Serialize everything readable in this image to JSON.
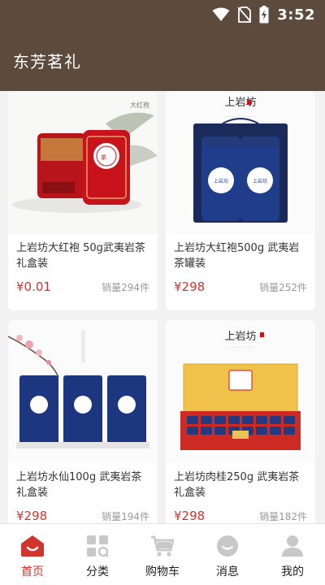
{
  "status_bar": {
    "time": "3:52"
  },
  "app_bar": {
    "title": "东芳茗礼"
  },
  "products": [
    {
      "title": "上岩坊大红袍 50g武夷岩茶礼盒装",
      "price": "¥0.01",
      "sales": "销量294件",
      "image": "red-tin-gift-box"
    },
    {
      "title": "上岩坊大红袍500g 武夷岩茶罐装",
      "price": "¥298",
      "sales": "销量252件",
      "image": "blue-tea-cans",
      "brand": "上岩坊"
    },
    {
      "title": "上岩坊水仙100g 武夷岩茶礼盒装",
      "price": "¥298",
      "sales": "销量194件",
      "image": "blue-tin-boxes"
    },
    {
      "title": "上岩坊肉桂250g 武夷岩茶礼盒装",
      "price": "¥298",
      "sales": "销量182件",
      "image": "red-gold-gift-box",
      "brand": "上岩坊"
    }
  ],
  "bottom_nav": [
    {
      "label": "首页",
      "icon": "home-icon",
      "active": true
    },
    {
      "label": "分类",
      "icon": "category-icon",
      "active": false
    },
    {
      "label": "购物车",
      "icon": "cart-icon",
      "active": false
    },
    {
      "label": "消息",
      "icon": "message-icon",
      "active": false
    },
    {
      "label": "我的",
      "icon": "profile-icon",
      "active": false
    }
  ],
  "colors": {
    "header": "#5c4a3d",
    "accent": "#d0342c",
    "inactive_icon": "#c8c8c8"
  }
}
